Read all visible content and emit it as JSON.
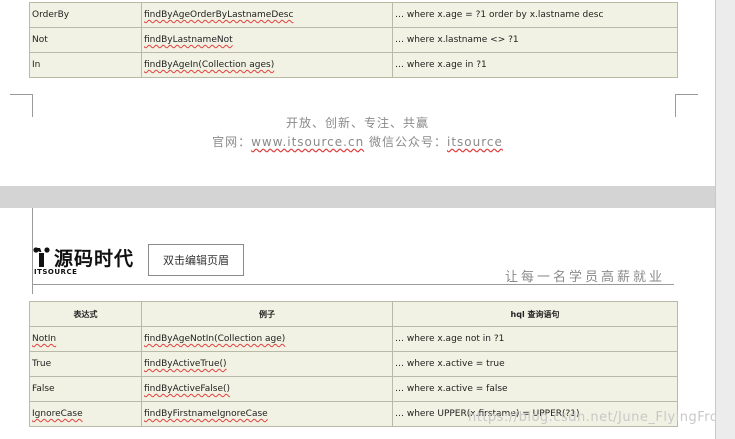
{
  "page1": {
    "rows": [
      {
        "keyword": "OrderBy",
        "sample": "findByAgeOrderByLastnameDesc",
        "hql": "… where x.age = ?1 order by x.lastname desc"
      },
      {
        "keyword": "Not",
        "sample": "findByLastnameNot",
        "hql": "… where x.lastname <> ?1"
      },
      {
        "keyword": "In",
        "sample": "findByAgeIn(Collection ages)",
        "hql": "… where x.age in ?1"
      }
    ],
    "footer_line1": "开放、创新、专注、共赢",
    "footer_line2_prefix": "官网：",
    "footer_site": "www.itsource.cn",
    "footer_line2_mid": "  微信公众号：",
    "footer_wechat": "itsource"
  },
  "page2": {
    "logo_text": "源码时代",
    "logo_sub": "ITSOURCE",
    "header_edit_button": "双击编辑页眉",
    "slogan": "让每一名学员高薪就业",
    "table_headers": [
      "表达式",
      "例子",
      "hql 查询语句"
    ],
    "rows": [
      {
        "keyword": "NotIn",
        "sample": "findByAgeNotIn(Collection age)",
        "hql": "… where x.age not in ?1"
      },
      {
        "keyword": "True",
        "sample": "findByActiveTrue()",
        "hql": "… where x.active = true"
      },
      {
        "keyword": "False",
        "sample": "findByActiveFalse()",
        "hql": "… where x.active = false"
      },
      {
        "keyword": "IgnoreCase",
        "sample": "findByFirstnameIgnoreCase",
        "hql": "… where UPPER(x.firstame) = UPPER(?1)"
      }
    ],
    "watermark": "https://blog.csdn.net/June_FlyingFrost"
  }
}
